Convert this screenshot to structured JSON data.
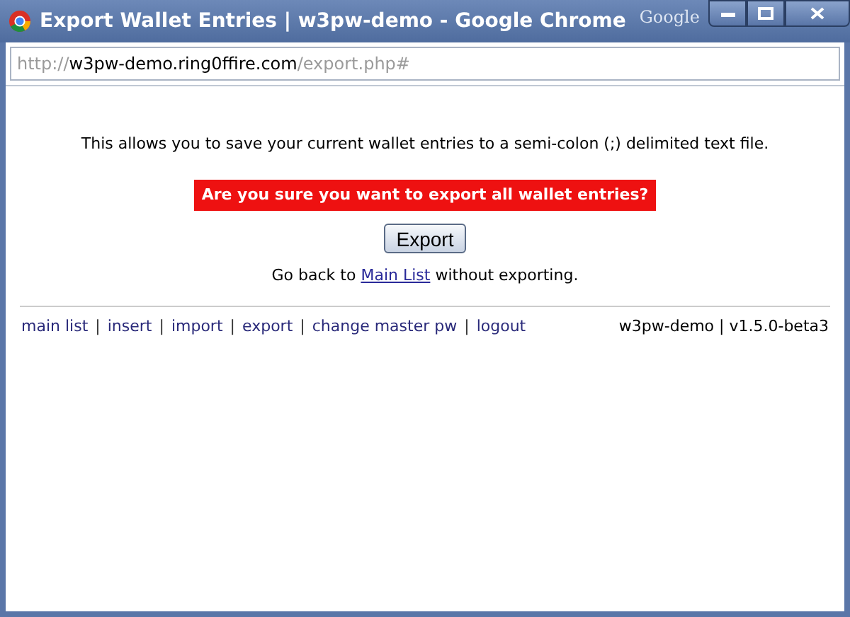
{
  "window": {
    "title": "Export Wallet Entries | w3pw-demo - Google Chrome",
    "brand": "Google"
  },
  "address": {
    "scheme": "http://",
    "host": "w3pw-demo.ring0ffire.com",
    "path": "/export.php#"
  },
  "intro": "This allows you to save your current wallet entries to a semi-colon (;) delimited text file.",
  "warning": "Are you sure you want to export all wallet entries?",
  "export_button": "Export",
  "back": {
    "before": "Go back to",
    "link": "Main List",
    "after": "without exporting."
  },
  "footer": {
    "separator": "|",
    "links": [
      "main list",
      "insert",
      "import",
      "export",
      "change master pw",
      "logout"
    ],
    "version": "w3pw-demo | v1.5.0-beta3"
  }
}
